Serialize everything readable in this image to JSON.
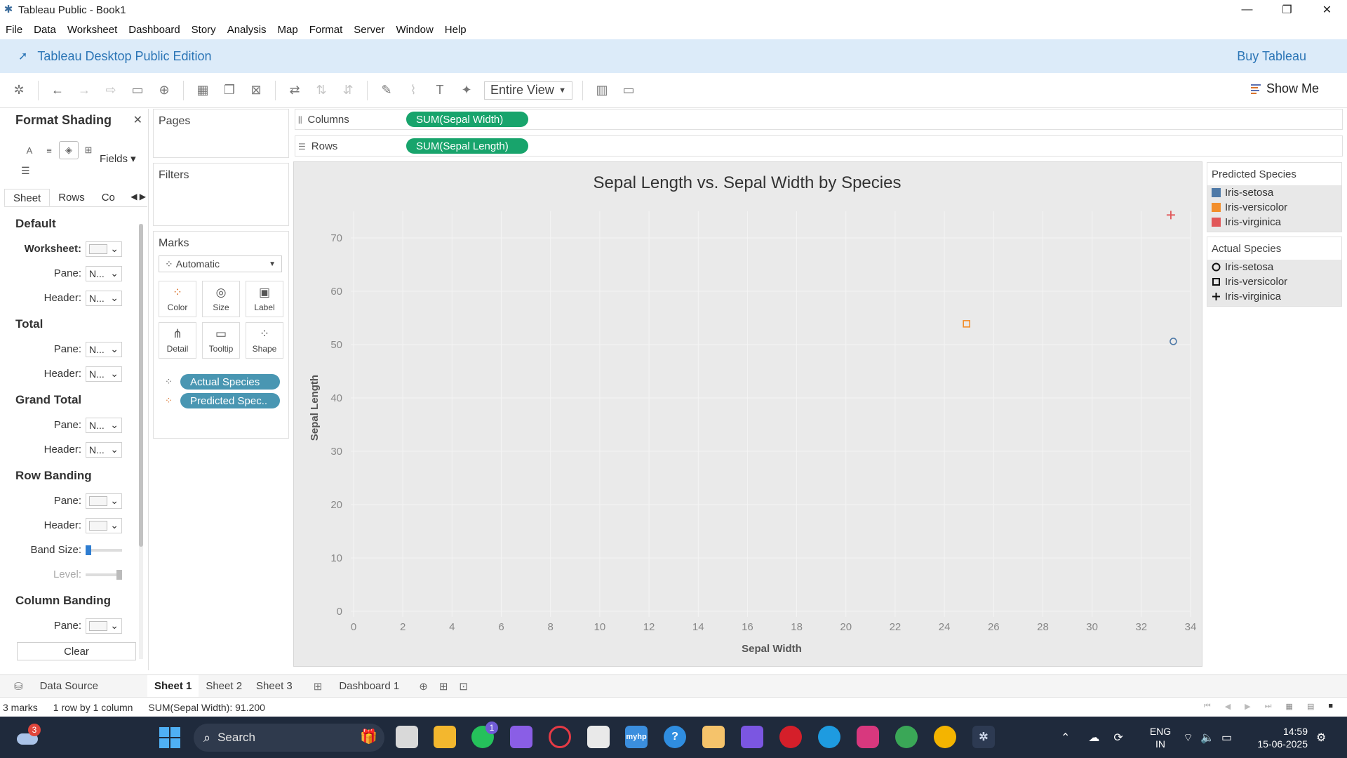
{
  "window": {
    "title": "Tableau Public - Book1",
    "controls": [
      "—",
      "❐",
      "✕"
    ]
  },
  "menu": [
    "File",
    "Data",
    "Worksheet",
    "Dashboard",
    "Story",
    "Analysis",
    "Map",
    "Format",
    "Server",
    "Window",
    "Help"
  ],
  "banner": {
    "edition": "Tableau Desktop Public Edition",
    "buy": "Buy Tableau"
  },
  "toolbar": {
    "view_mode": "Entire View",
    "show_me": "Show Me"
  },
  "format_pane": {
    "title": "Format Shading",
    "fields_label": "Fields",
    "tabs": [
      "Sheet",
      "Rows",
      "Co"
    ],
    "default": {
      "heading": "Default",
      "worksheet_label": "Worksheet:",
      "pane_label": "Pane:",
      "pane_value": "N...",
      "header_label": "Header:",
      "header_value": "N..."
    },
    "total": {
      "heading": "Total",
      "pane_label": "Pane:",
      "pane_value": "N...",
      "header_label": "Header:",
      "header_value": "N..."
    },
    "grand_total": {
      "heading": "Grand Total",
      "pane_label": "Pane:",
      "pane_value": "N...",
      "header_label": "Header:",
      "header_value": "N..."
    },
    "row_banding": {
      "heading": "Row Banding",
      "pane_label": "Pane:",
      "header_label": "Header:",
      "band_size_label": "Band Size:",
      "level_label": "Level:"
    },
    "column_banding": {
      "heading": "Column Banding",
      "pane_label": "Pane:"
    },
    "clear_label": "Clear"
  },
  "cards": {
    "pages": "Pages",
    "filters": "Filters",
    "marks": {
      "title": "Marks",
      "type": "Automatic",
      "buttons": [
        "Color",
        "Size",
        "Label",
        "Detail",
        "Tooltip",
        "Shape"
      ],
      "pills": [
        "Actual Species",
        "Predicted Spec.."
      ]
    }
  },
  "shelves": {
    "columns_label": "Columns",
    "columns_pill": "SUM(Sepal Width)",
    "rows_label": "Rows",
    "rows_pill": "SUM(Sepal Length)"
  },
  "legends": {
    "predicted": {
      "title": "Predicted Species",
      "items": [
        {
          "label": "Iris-setosa",
          "color": "#4e79a7"
        },
        {
          "label": "Iris-versicolor",
          "color": "#f28e2b"
        },
        {
          "label": "Iris-virginica",
          "color": "#e15759"
        }
      ]
    },
    "actual": {
      "title": "Actual Species",
      "items": [
        {
          "label": "Iris-setosa",
          "shape": "circle"
        },
        {
          "label": "Iris-versicolor",
          "shape": "square"
        },
        {
          "label": "Iris-virginica",
          "shape": "plus"
        }
      ]
    }
  },
  "chart_data": {
    "type": "scatter",
    "title": "Sepal Length vs. Sepal Width by Species",
    "xlabel": "Sepal Width",
    "ylabel": "Sepal Length",
    "xlim": [
      0,
      34
    ],
    "ylim": [
      0,
      75
    ],
    "xticks": [
      0,
      2,
      4,
      6,
      8,
      10,
      12,
      14,
      16,
      18,
      20,
      22,
      24,
      26,
      28,
      30,
      32,
      34
    ],
    "yticks": [
      0,
      10,
      20,
      30,
      40,
      50,
      60,
      70
    ],
    "grid": true,
    "points": [
      {
        "x": 33.2,
        "y": 74.3,
        "predicted": "Iris-virginica",
        "actual": "Iris-virginica",
        "shape": "plus",
        "color": "#e15759"
      },
      {
        "x": 24.9,
        "y": 53.9,
        "predicted": "Iris-versicolor",
        "actual": "Iris-versicolor",
        "shape": "square",
        "color": "#f28e2b"
      },
      {
        "x": 33.3,
        "y": 50.6,
        "predicted": "Iris-setosa",
        "actual": "Iris-setosa",
        "shape": "circle",
        "color": "#4e79a7"
      }
    ]
  },
  "sheet_tabs": {
    "data_source": "Data Source",
    "sheets": [
      "Sheet 1",
      "Sheet 2",
      "Sheet 3"
    ],
    "dashboard": "Dashboard 1"
  },
  "status": {
    "marks": "3 marks",
    "dims": "1 row by 1 column",
    "sum": "SUM(Sepal Width): 91.200"
  },
  "taskbar": {
    "weather_badge": "3",
    "search_placeholder": "Search",
    "whatsapp_badge": "1",
    "lang_line1": "ENG",
    "lang_line2": "IN",
    "time": "14:59",
    "date": "15-06-2025"
  }
}
